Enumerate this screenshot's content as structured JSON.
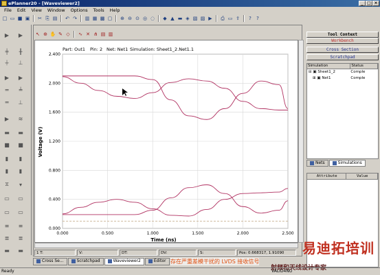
{
  "window": {
    "title": "ePlanner20 - [Waveviewer2]",
    "min": "_",
    "max": "□",
    "close": "×"
  },
  "menu": [
    "File",
    "Edit",
    "View",
    "Window",
    "Options",
    "Tools",
    "Help"
  ],
  "plot_info": {
    "part": "Part: Out1",
    "pin": "Pin: 2",
    "net": "Net: Net1",
    "simulation": "Simulation: Sheet1_2.Net1.1"
  },
  "chart_data": {
    "type": "line",
    "xlabel": "Time (ns)",
    "ylabel": "Voltage (V)",
    "xlim": [
      0,
      2.5
    ],
    "ylim": [
      0,
      2.4
    ],
    "x_ticks": [
      "0.000",
      "0.500",
      "1.000",
      "1.500",
      "2.000",
      "2.500"
    ],
    "y_ticks": [
      "0.000",
      "0.400",
      "0.800",
      "1.200",
      "1.600",
      "2.000",
      "2.400"
    ],
    "grid": true,
    "colors": {
      "trace": "#b03060",
      "baseline": "#c8b090"
    },
    "series": [
      {
        "x": [
          0,
          0.2,
          0.4,
          0.6,
          0.8,
          1.0,
          1.2,
          1.4,
          1.6,
          1.8,
          2.0,
          2.2,
          2.4,
          2.5
        ],
        "y": [
          2.09,
          2.0,
          1.9,
          1.82,
          1.79,
          1.87,
          2.01,
          2.06,
          2.03,
          1.93,
          1.75,
          1.65,
          1.63,
          1.63
        ]
      },
      {
        "x": [
          0,
          0.2,
          0.4,
          0.6,
          0.8,
          1.0,
          1.2,
          1.4,
          1.6,
          1.8,
          2.0,
          2.2,
          2.4,
          2.5
        ],
        "y": [
          2.1,
          2.1,
          2.1,
          2.1,
          2.1,
          2.05,
          1.77,
          1.55,
          1.5,
          1.65,
          1.86,
          2.03,
          1.98,
          1.65
        ]
      },
      {
        "x": [
          0,
          0.2,
          0.4,
          0.6,
          0.8,
          1.0,
          1.2,
          1.4,
          1.6,
          1.8,
          2.0,
          2.2,
          2.4,
          2.5
        ],
        "y": [
          0.2,
          0.29,
          0.36,
          0.4,
          0.36,
          0.27,
          0.18,
          0.17,
          0.26,
          0.4,
          0.48,
          0.49,
          0.5,
          0.55
        ]
      },
      {
        "x": [
          0,
          0.2,
          0.4,
          0.6,
          0.8,
          1.0,
          1.2,
          1.4,
          1.6,
          1.8,
          2.0,
          2.2,
          2.4,
          2.5
        ],
        "y": [
          0.19,
          0.19,
          0.19,
          0.19,
          0.19,
          0.25,
          0.42,
          0.56,
          0.6,
          0.48,
          0.3,
          0.21,
          0.25,
          0.38
        ]
      },
      {
        "x": [
          0,
          2.5
        ],
        "y": [
          0.1,
          0.1
        ],
        "dashed": true
      }
    ]
  },
  "statusline": {
    "t1": "1 T:",
    "v": "V:",
    "dt": "DT:",
    "dv": "DV:",
    "s": "S:",
    "pos": "Pos: 0.668317, 1.91090"
  },
  "tabs": [
    "Cross Se...",
    "Scratchpad",
    "Waveviewer2",
    "Editor"
  ],
  "right_panel": {
    "tool_context": "Tool Context",
    "workbench": "Workbench",
    "cross_section": "Cross Section",
    "scratchpad": "Scratchpad",
    "columns": [
      "Simulation",
      "Status"
    ],
    "tree": [
      {
        "name": "Sheet1_2",
        "status": "Comple"
      },
      {
        "name": "Net1",
        "status": "Comple"
      }
    ],
    "tree_tabs": [
      "Nets",
      "Simulations"
    ],
    "attr_columns": [
      "Attribute",
      "Value"
    ]
  },
  "status_bar": {
    "left": "Ready",
    "right": "VALID4NU"
  },
  "overlay": {
    "caption": "存在严重差模干扰的 LVDS 接收信号",
    "brand": "易迪拓培训",
    "brand_sub": "射频和天线设计专家"
  }
}
